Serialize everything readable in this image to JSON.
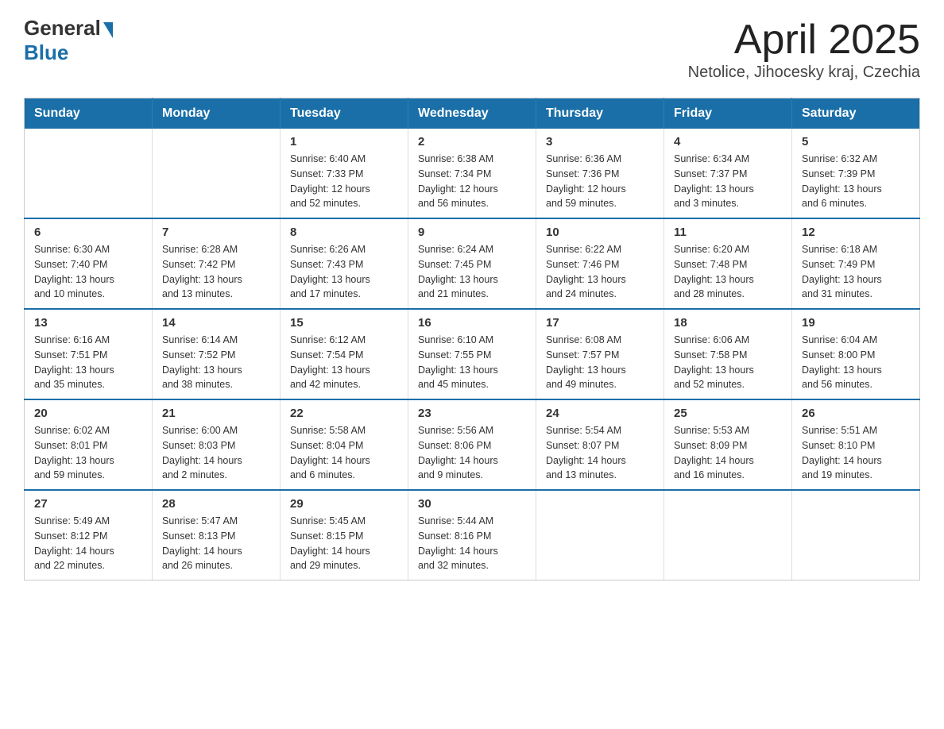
{
  "header": {
    "logo_general": "General",
    "logo_blue": "Blue",
    "title": "April 2025",
    "subtitle": "Netolice, Jihocesky kraj, Czechia"
  },
  "calendar": {
    "weekdays": [
      "Sunday",
      "Monday",
      "Tuesday",
      "Wednesday",
      "Thursday",
      "Friday",
      "Saturday"
    ],
    "weeks": [
      [
        {
          "day": "",
          "info": ""
        },
        {
          "day": "",
          "info": ""
        },
        {
          "day": "1",
          "info": "Sunrise: 6:40 AM\nSunset: 7:33 PM\nDaylight: 12 hours\nand 52 minutes."
        },
        {
          "day": "2",
          "info": "Sunrise: 6:38 AM\nSunset: 7:34 PM\nDaylight: 12 hours\nand 56 minutes."
        },
        {
          "day": "3",
          "info": "Sunrise: 6:36 AM\nSunset: 7:36 PM\nDaylight: 12 hours\nand 59 minutes."
        },
        {
          "day": "4",
          "info": "Sunrise: 6:34 AM\nSunset: 7:37 PM\nDaylight: 13 hours\nand 3 minutes."
        },
        {
          "day": "5",
          "info": "Sunrise: 6:32 AM\nSunset: 7:39 PM\nDaylight: 13 hours\nand 6 minutes."
        }
      ],
      [
        {
          "day": "6",
          "info": "Sunrise: 6:30 AM\nSunset: 7:40 PM\nDaylight: 13 hours\nand 10 minutes."
        },
        {
          "day": "7",
          "info": "Sunrise: 6:28 AM\nSunset: 7:42 PM\nDaylight: 13 hours\nand 13 minutes."
        },
        {
          "day": "8",
          "info": "Sunrise: 6:26 AM\nSunset: 7:43 PM\nDaylight: 13 hours\nand 17 minutes."
        },
        {
          "day": "9",
          "info": "Sunrise: 6:24 AM\nSunset: 7:45 PM\nDaylight: 13 hours\nand 21 minutes."
        },
        {
          "day": "10",
          "info": "Sunrise: 6:22 AM\nSunset: 7:46 PM\nDaylight: 13 hours\nand 24 minutes."
        },
        {
          "day": "11",
          "info": "Sunrise: 6:20 AM\nSunset: 7:48 PM\nDaylight: 13 hours\nand 28 minutes."
        },
        {
          "day": "12",
          "info": "Sunrise: 6:18 AM\nSunset: 7:49 PM\nDaylight: 13 hours\nand 31 minutes."
        }
      ],
      [
        {
          "day": "13",
          "info": "Sunrise: 6:16 AM\nSunset: 7:51 PM\nDaylight: 13 hours\nand 35 minutes."
        },
        {
          "day": "14",
          "info": "Sunrise: 6:14 AM\nSunset: 7:52 PM\nDaylight: 13 hours\nand 38 minutes."
        },
        {
          "day": "15",
          "info": "Sunrise: 6:12 AM\nSunset: 7:54 PM\nDaylight: 13 hours\nand 42 minutes."
        },
        {
          "day": "16",
          "info": "Sunrise: 6:10 AM\nSunset: 7:55 PM\nDaylight: 13 hours\nand 45 minutes."
        },
        {
          "day": "17",
          "info": "Sunrise: 6:08 AM\nSunset: 7:57 PM\nDaylight: 13 hours\nand 49 minutes."
        },
        {
          "day": "18",
          "info": "Sunrise: 6:06 AM\nSunset: 7:58 PM\nDaylight: 13 hours\nand 52 minutes."
        },
        {
          "day": "19",
          "info": "Sunrise: 6:04 AM\nSunset: 8:00 PM\nDaylight: 13 hours\nand 56 minutes."
        }
      ],
      [
        {
          "day": "20",
          "info": "Sunrise: 6:02 AM\nSunset: 8:01 PM\nDaylight: 13 hours\nand 59 minutes."
        },
        {
          "day": "21",
          "info": "Sunrise: 6:00 AM\nSunset: 8:03 PM\nDaylight: 14 hours\nand 2 minutes."
        },
        {
          "day": "22",
          "info": "Sunrise: 5:58 AM\nSunset: 8:04 PM\nDaylight: 14 hours\nand 6 minutes."
        },
        {
          "day": "23",
          "info": "Sunrise: 5:56 AM\nSunset: 8:06 PM\nDaylight: 14 hours\nand 9 minutes."
        },
        {
          "day": "24",
          "info": "Sunrise: 5:54 AM\nSunset: 8:07 PM\nDaylight: 14 hours\nand 13 minutes."
        },
        {
          "day": "25",
          "info": "Sunrise: 5:53 AM\nSunset: 8:09 PM\nDaylight: 14 hours\nand 16 minutes."
        },
        {
          "day": "26",
          "info": "Sunrise: 5:51 AM\nSunset: 8:10 PM\nDaylight: 14 hours\nand 19 minutes."
        }
      ],
      [
        {
          "day": "27",
          "info": "Sunrise: 5:49 AM\nSunset: 8:12 PM\nDaylight: 14 hours\nand 22 minutes."
        },
        {
          "day": "28",
          "info": "Sunrise: 5:47 AM\nSunset: 8:13 PM\nDaylight: 14 hours\nand 26 minutes."
        },
        {
          "day": "29",
          "info": "Sunrise: 5:45 AM\nSunset: 8:15 PM\nDaylight: 14 hours\nand 29 minutes."
        },
        {
          "day": "30",
          "info": "Sunrise: 5:44 AM\nSunset: 8:16 PM\nDaylight: 14 hours\nand 32 minutes."
        },
        {
          "day": "",
          "info": ""
        },
        {
          "day": "",
          "info": ""
        },
        {
          "day": "",
          "info": ""
        }
      ]
    ]
  }
}
